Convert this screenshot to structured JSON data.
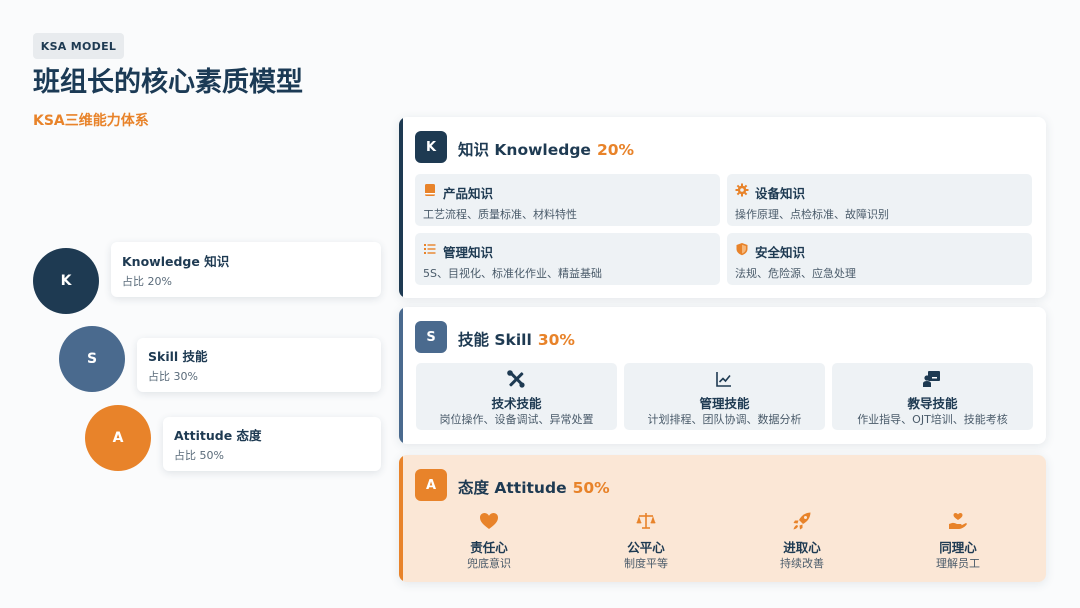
{
  "header": {
    "tag": "KSA MODEL",
    "title": "班组长的核心素质模型",
    "subtitle": "KSA三维能力体系"
  },
  "colors": {
    "knowledge": "#1e3a52",
    "skill": "#4a6a8e",
    "attitude": "#e8832a",
    "highlight": "#e8832a"
  },
  "legend": [
    {
      "letter": "K",
      "title": "Knowledge 知识",
      "sub": "占比 20%"
    },
    {
      "letter": "S",
      "title": "Skill 技能",
      "sub": "占比 30%"
    },
    {
      "letter": "A",
      "title": "Attitude 态度",
      "sub": "占比 50%"
    }
  ],
  "knowledge": {
    "badge": "K",
    "title": "知识 Knowledge",
    "pct": "20%",
    "items": [
      {
        "icon": "book-icon",
        "title": "产品知识",
        "sub": "工艺流程、质量标准、材料特性"
      },
      {
        "icon": "gear-icon",
        "title": "设备知识",
        "sub": "操作原理、点检标准、故障识别"
      },
      {
        "icon": "list-icon",
        "title": "管理知识",
        "sub": "5S、目视化、标准化作业、精益基础"
      },
      {
        "icon": "shield-icon",
        "title": "安全知识",
        "sub": "法规、危险源、应急处理"
      }
    ]
  },
  "skill": {
    "badge": "S",
    "title": "技能 Skill",
    "pct": "30%",
    "items": [
      {
        "icon": "tools-icon",
        "title": "技术技能",
        "sub": "岗位操作、设备调试、异常处置"
      },
      {
        "icon": "line-chart-icon",
        "title": "管理技能",
        "sub": "计划排程、团队协调、数据分析"
      },
      {
        "icon": "teaching-icon",
        "title": "教导技能",
        "sub": "作业指导、OJT培训、技能考核"
      }
    ]
  },
  "attitude": {
    "badge": "A",
    "title": "态度 Attitude",
    "pct": "50%",
    "items": [
      {
        "icon": "heart-icon",
        "title": "责任心",
        "sub": "兜底意识"
      },
      {
        "icon": "balance-scale-icon",
        "title": "公平心",
        "sub": "制度平等"
      },
      {
        "icon": "rocket-icon",
        "title": "进取心",
        "sub": "持续改善"
      },
      {
        "icon": "hand-heart-icon",
        "title": "同理心",
        "sub": "理解员工"
      }
    ]
  }
}
